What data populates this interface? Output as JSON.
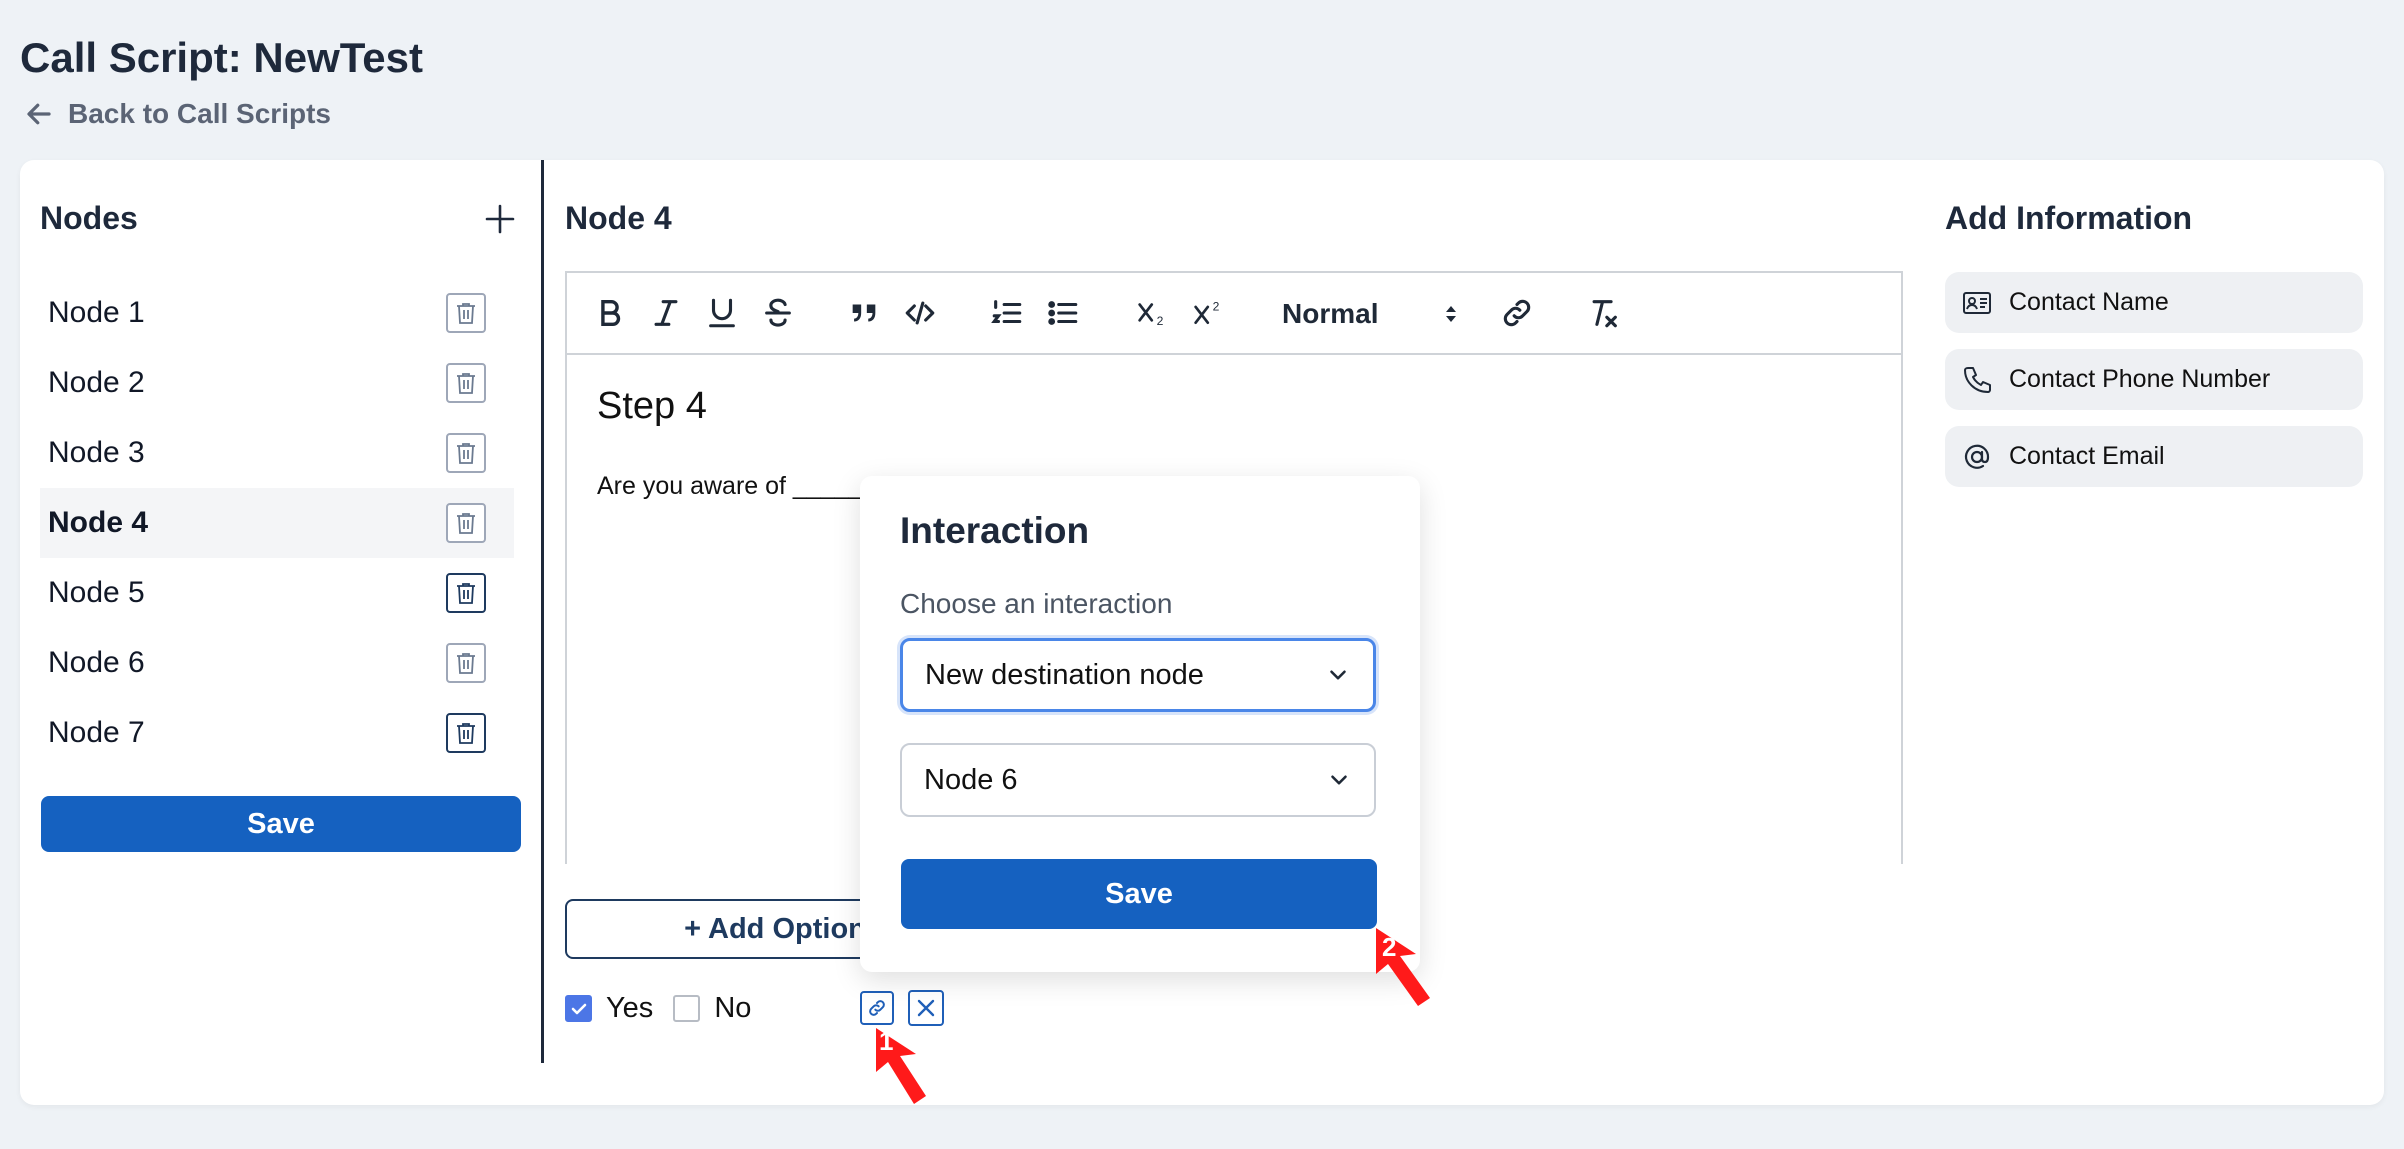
{
  "header": {
    "title": "Call Script: NewTest",
    "back_label": "Back to Call Scripts"
  },
  "nodes_panel": {
    "title": "Nodes",
    "items": [
      {
        "label": "Node 1"
      },
      {
        "label": "Node 2"
      },
      {
        "label": "Node 3"
      },
      {
        "label": "Node 4",
        "active": true
      },
      {
        "label": "Node 5"
      },
      {
        "label": "Node 6"
      },
      {
        "label": "Node 7"
      }
    ],
    "save_label": "Save"
  },
  "editor": {
    "node_title": "Node 4",
    "toolbar": {
      "heading_select": "Normal",
      "buttons": [
        "bold-icon",
        "italic-icon",
        "underline-icon",
        "strikethrough-icon",
        "blockquote-icon",
        "code-icon",
        "ordered-list-icon",
        "bullet-list-icon",
        "subscript-icon",
        "superscript-icon",
        "link-icon",
        "clear-format-icon"
      ]
    },
    "content": {
      "heading": "Step 4",
      "text": "Are you aware of _____"
    },
    "add_option_label": "+ Add Option",
    "options": [
      {
        "label": "Yes",
        "checked": true
      },
      {
        "label": "No",
        "checked": false
      }
    ]
  },
  "info_panel": {
    "title": "Add Information",
    "items": [
      {
        "label": "Contact Name",
        "icon": "contact-card-icon"
      },
      {
        "label": "Contact Phone Number",
        "icon": "phone-icon"
      },
      {
        "label": "Contact Email",
        "icon": "at-sign-icon"
      }
    ]
  },
  "popup": {
    "title": "Interaction",
    "label": "Choose an interaction",
    "interaction_value": "New destination node",
    "node_value": "Node 6",
    "save_label": "Save"
  },
  "annotations": {
    "marker_1": "1",
    "marker_2": "2",
    "color": "#ff0000"
  }
}
